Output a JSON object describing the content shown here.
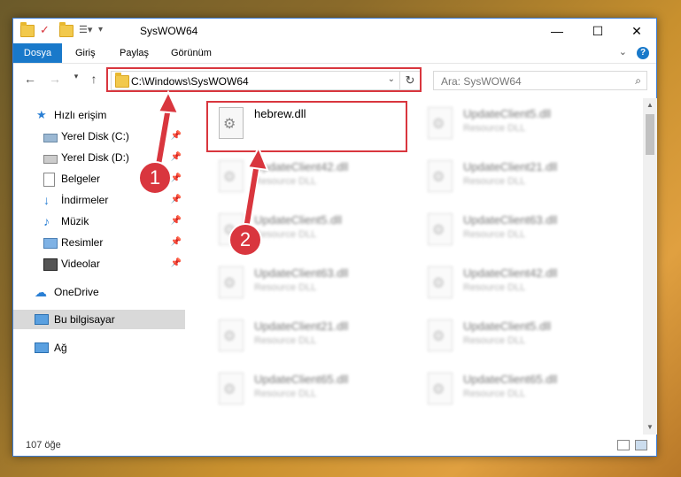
{
  "window": {
    "title": "SysWOW64",
    "controls": {
      "minimize": "—",
      "maximize": "☐",
      "close": "✕"
    }
  },
  "ribbon": {
    "tabs": [
      "Dosya",
      "Giriş",
      "Paylaş",
      "Görünüm"
    ]
  },
  "address_bar": {
    "path": "C:\\Windows\\SysWOW64",
    "search_placeholder": "Ara: SysWOW64"
  },
  "sidebar": {
    "items": [
      {
        "label": "Hızlı erişim",
        "icon": "star-icon",
        "pinned": false
      },
      {
        "label": "Yerel Disk (C:)",
        "icon": "drive-icon",
        "pinned": true
      },
      {
        "label": "Yerel Disk (D:)",
        "icon": "drive-icon",
        "pinned": true
      },
      {
        "label": "Belgeler",
        "icon": "documents-icon",
        "pinned": true
      },
      {
        "label": "İndirmeler",
        "icon": "download-icon",
        "pinned": true
      },
      {
        "label": "Müzik",
        "icon": "music-icon",
        "pinned": true
      },
      {
        "label": "Resimler",
        "icon": "pictures-icon",
        "pinned": true
      },
      {
        "label": "Videolar",
        "icon": "video-icon",
        "pinned": true
      },
      {
        "label": "OneDrive",
        "icon": "cloud-icon",
        "pinned": false
      },
      {
        "label": "Bu bilgisayar",
        "icon": "computer-icon",
        "pinned": false,
        "selected": true
      },
      {
        "label": "Ağ",
        "icon": "network-icon",
        "pinned": false
      }
    ]
  },
  "files": [
    {
      "name": "hebrew.dll",
      "desc": "",
      "highlighted": true
    },
    {
      "name": "UpdateClient5.dll",
      "desc": "Resource DLL"
    },
    {
      "name": "UpdateClient42.dll",
      "desc": "Resource DLL"
    },
    {
      "name": "UpdateClient21.dll",
      "desc": "Resource DLL"
    },
    {
      "name": "UpdateClient5.dll",
      "desc": "Resource DLL"
    },
    {
      "name": "UpdateClient63.dll",
      "desc": "Resource DLL"
    },
    {
      "name": "UpdateClient63.dll",
      "desc": "Resource DLL"
    },
    {
      "name": "UpdateClient42.dll",
      "desc": "Resource DLL"
    },
    {
      "name": "UpdateClient21.dll",
      "desc": "Resource DLL"
    },
    {
      "name": "UpdateClient5.dll",
      "desc": "Resource DLL"
    },
    {
      "name": "UpdateClient65.dll",
      "desc": "Resource DLL"
    },
    {
      "name": "UpdateClient65.dll",
      "desc": "Resource DLL"
    }
  ],
  "status": {
    "count": "107 öğe"
  },
  "annotations": {
    "step1": "1",
    "step2": "2",
    "color": "#d9363e"
  }
}
